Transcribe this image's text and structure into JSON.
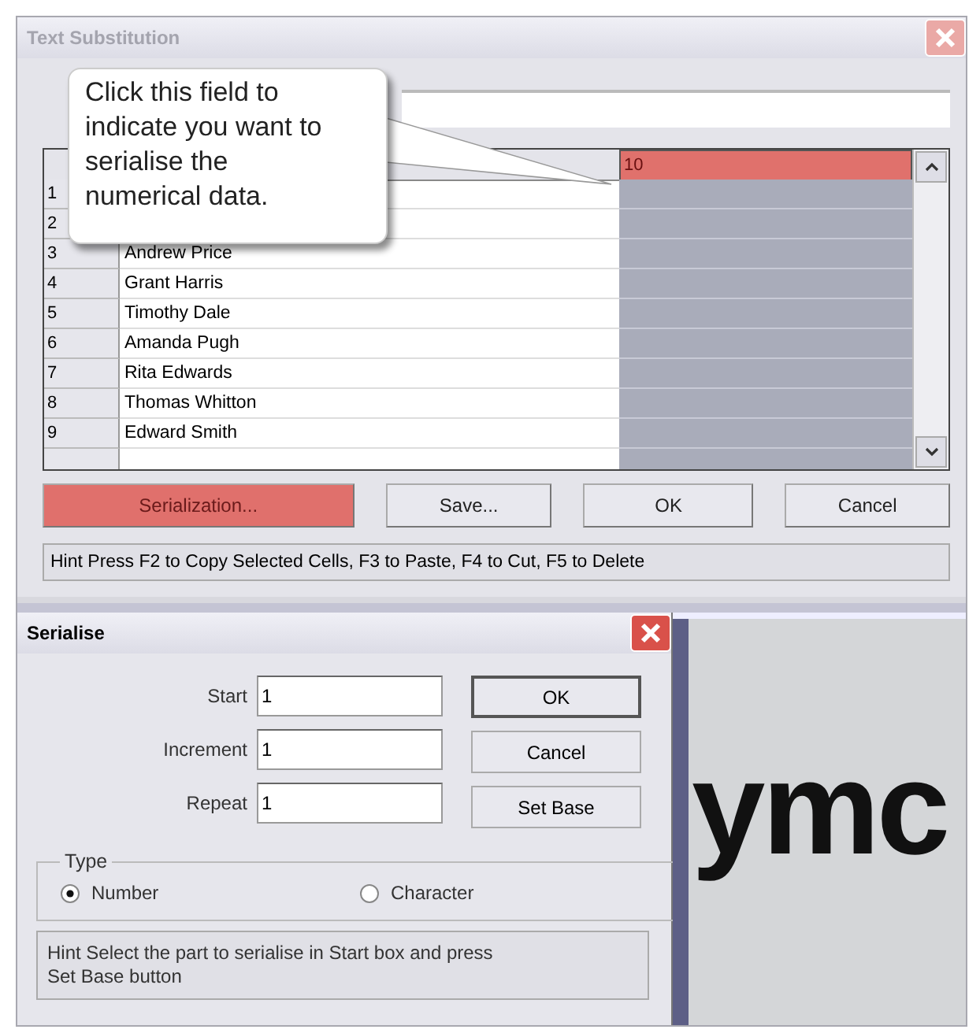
{
  "main_window": {
    "title": "Text Substitution"
  },
  "grid": {
    "header_value": "10",
    "header_selected": true,
    "rows": [
      {
        "number": "1"
      },
      {
        "number": "2"
      },
      {
        "number": "3",
        "name": "Andrew Price"
      },
      {
        "number": "4",
        "name": "Grant Harris"
      },
      {
        "number": "5",
        "name": "Timothy Dale"
      },
      {
        "number": "6",
        "name": "Amanda Pugh"
      },
      {
        "number": "7",
        "name": "Rita Edwards"
      },
      {
        "number": "8",
        "name": "Thomas Whitton"
      },
      {
        "number": "9",
        "name": "Edward Smith"
      }
    ]
  },
  "buttons": [
    {
      "label": "Serialization...",
      "highlighted": true
    },
    {
      "label": "Save...",
      "highlighted": false
    },
    {
      "label": "OK",
      "highlighted": false
    },
    {
      "label": "Cancel",
      "highlighted": false
    }
  ],
  "hint": "Hint Press F2 to Copy Selected Cells, F3 to Paste, F4 to Cut, F5 to Delete",
  "callout": {
    "text": "Click this field to indicate you want to serialise the numerical data."
  },
  "dialog": {
    "title": "Serialise",
    "fields": [
      {
        "label": "Start",
        "value": "1"
      },
      {
        "label": "Increment",
        "value": "1"
      },
      {
        "label": "Repeat",
        "value": "1"
      }
    ],
    "buttons": [
      {
        "label": "OK",
        "default": true
      },
      {
        "label": "Cancel",
        "default": false
      },
      {
        "label": "Set Base",
        "default": false
      }
    ],
    "type_group": {
      "title": "Type",
      "options": [
        {
          "label": "Number",
          "selected": true
        },
        {
          "label": "Character",
          "selected": false
        }
      ]
    },
    "hint": "Hint Select the part to serialise in Start box and press Set Base button"
  },
  "background_text": "ymc"
}
